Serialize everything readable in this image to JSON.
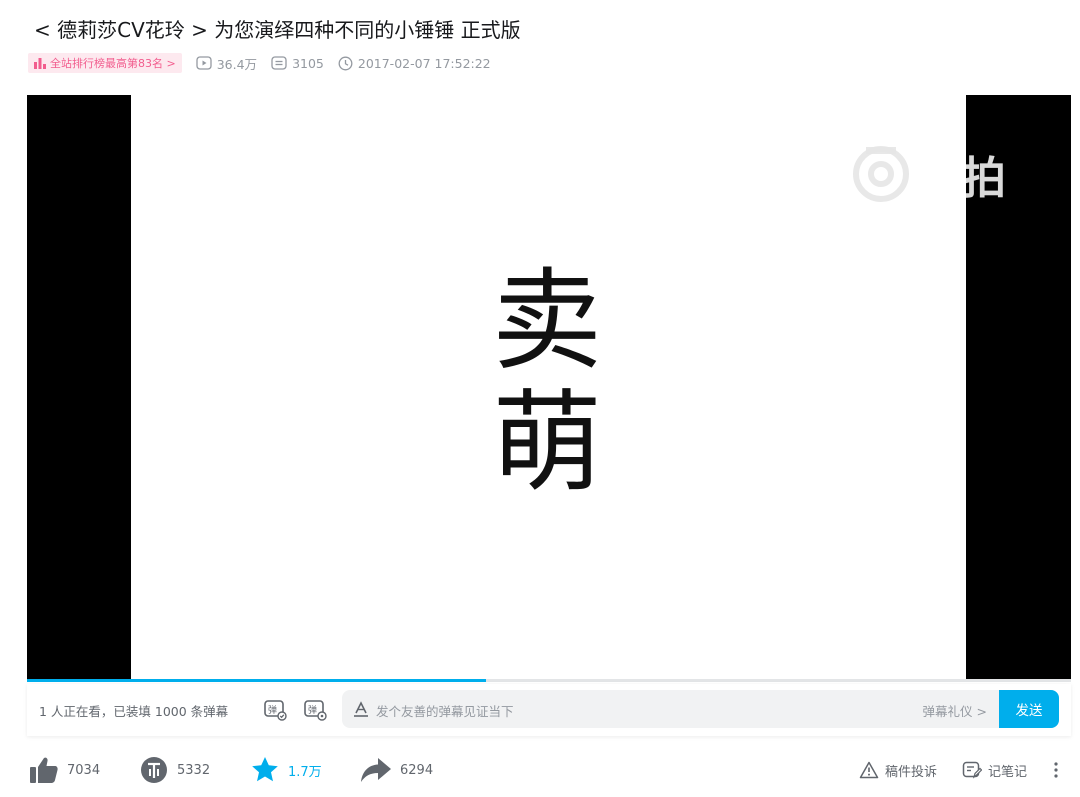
{
  "video": {
    "title": "< 德莉莎CV花玲 > 为您演绎四种不同的小锤锤 正式版",
    "rank_badge": "全站排行榜最高第83名 >",
    "views": "36.4万",
    "danmaku_count": "3105",
    "publish_time": "2017-02-07 17:52:22"
  },
  "player": {
    "frame_text_line1": "卖",
    "frame_text_line2": "萌",
    "watermark": "秒拍",
    "progress_fraction": 0.44
  },
  "danmaku": {
    "watching_text": "1 人正在看，已装填 1000 条弹幕",
    "input_placeholder": "发个友善的弹幕见证当下",
    "etiquette_link": "弹幕礼仪 >",
    "send_label": "发送"
  },
  "toolbar": {
    "like_count": "7034",
    "coin_count": "5332",
    "favorite_count": "1.7万",
    "share_count": "6294",
    "report_label": "稿件投诉",
    "notes_label": "记笔记"
  },
  "colors": {
    "accent": "#00aeec",
    "badge_pink": "#f25d8e"
  }
}
